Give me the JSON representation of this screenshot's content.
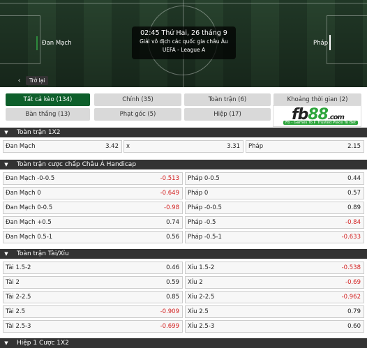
{
  "match": {
    "time": "02:45 Thứ Hai, 26 tháng 9",
    "league": "Giải vô địch các quốc gia châu Âu UEFA - League A",
    "home": "Đan Mạch",
    "away": "Pháp"
  },
  "nav": {
    "back_label": "Trở lại"
  },
  "tabs": [
    {
      "label": "Tất cả kèo (134)",
      "active": true
    },
    {
      "label": "Chính (35)"
    },
    {
      "label": "Toàn trận (6)"
    },
    {
      "label": "Khoảng thời gian (2)"
    },
    {
      "label": "Bàn thắng (13)"
    },
    {
      "label": "Phạt góc (5)"
    },
    {
      "label": "Hiệp (17)"
    }
  ],
  "ad": {
    "brand_a": "fb",
    "brand_b": "88",
    "brand_c": ".com",
    "tag1": "Fb - Games To Play",
    "tag2": "Trusted Place To Bet"
  },
  "sections": {
    "s1x2": {
      "title": "Toàn trận 1X2",
      "cells": [
        {
          "label": "Đan Mạch",
          "value": "3.42"
        },
        {
          "label": "x",
          "value": "3.31"
        },
        {
          "label": "Pháp",
          "value": "2.15"
        }
      ]
    },
    "handicap": {
      "title": "Toàn trận cược chấp Châu Á Handicap",
      "rows": [
        {
          "left": {
            "label": "Đan Mạch -0-0.5",
            "value": "-0.513"
          },
          "right": {
            "label": "Pháp 0-0.5",
            "value": "0.44"
          }
        },
        {
          "left": {
            "label": "Đan Mạch 0",
            "value": "-0.649"
          },
          "right": {
            "label": "Pháp 0",
            "value": "0.57"
          }
        },
        {
          "left": {
            "label": "Đan Mạch 0-0.5",
            "value": "-0.98"
          },
          "right": {
            "label": "Pháp -0-0.5",
            "value": "0.89"
          }
        },
        {
          "left": {
            "label": "Đan Mạch +0.5",
            "value": "0.74"
          },
          "right": {
            "label": "Pháp -0.5",
            "value": "-0.84"
          }
        },
        {
          "left": {
            "label": "Đan Mạch 0.5-1",
            "value": "0.56"
          },
          "right": {
            "label": "Pháp -0.5-1",
            "value": "-0.633"
          }
        }
      ]
    },
    "overunder": {
      "title": "Toàn trận Tài/Xỉu",
      "rows": [
        {
          "left": {
            "label": "Tài 1.5-2",
            "value": "0.46"
          },
          "right": {
            "label": "Xỉu 1.5-2",
            "value": "-0.538"
          }
        },
        {
          "left": {
            "label": "Tài 2",
            "value": "0.59"
          },
          "right": {
            "label": "Xỉu 2",
            "value": "-0.69"
          }
        },
        {
          "left": {
            "label": "Tài 2-2.5",
            "value": "0.85"
          },
          "right": {
            "label": "Xỉu 2-2.5",
            "value": "-0.962"
          }
        },
        {
          "left": {
            "label": "Tài 2.5",
            "value": "-0.909"
          },
          "right": {
            "label": "Xỉu 2.5",
            "value": "0.79"
          }
        },
        {
          "left": {
            "label": "Tài 2.5-3",
            "value": "-0.699"
          },
          "right": {
            "label": "Xỉu 2.5-3",
            "value": "0.60"
          }
        }
      ]
    },
    "half1x2": {
      "title": "Hiệp 1 Cược 1X2"
    }
  },
  "icons": {
    "section_toggle": "triangle-down-icon",
    "back": "chevron-left-icon"
  },
  "colors": {
    "accent": "#0e5f2b",
    "negative": "#d32020",
    "header_bg": "#333333"
  }
}
